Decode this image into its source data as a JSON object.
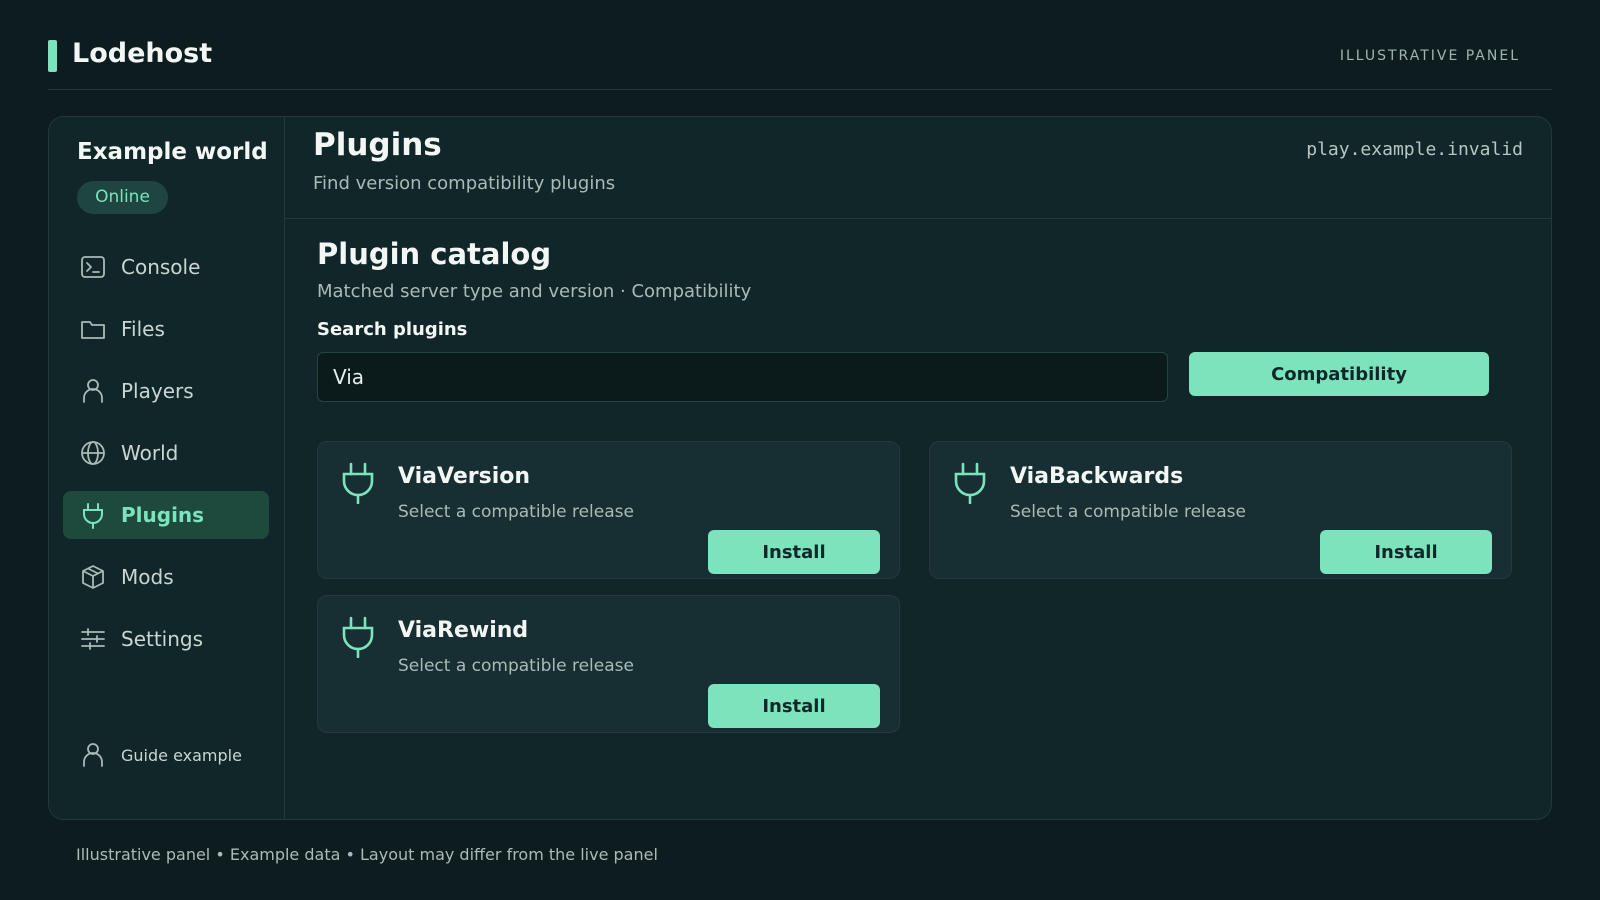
{
  "app": {
    "brand": "Lodehost",
    "top_label": "ILLUSTRATIVE PANEL",
    "accent_color": "#7ce3bd"
  },
  "sidebar": {
    "world_name": "Example world",
    "status": "Online",
    "items": [
      {
        "label": "Console",
        "icon": "terminal-icon",
        "active": false
      },
      {
        "label": "Files",
        "icon": "folder-icon",
        "active": false
      },
      {
        "label": "Players",
        "icon": "user-icon",
        "active": false
      },
      {
        "label": "World",
        "icon": "globe-icon",
        "active": false
      },
      {
        "label": "Plugins",
        "icon": "plug-icon",
        "active": true
      },
      {
        "label": "Mods",
        "icon": "package-icon",
        "active": false
      },
      {
        "label": "Settings",
        "icon": "sliders-icon",
        "active": false
      }
    ],
    "guide_label": "Guide example"
  },
  "header": {
    "title": "Plugins",
    "subtitle": "Find version compatibility plugins",
    "host": "play.example.invalid"
  },
  "catalog": {
    "title": "Plugin catalog",
    "subtitle": "Matched server type and version · Compatibility",
    "search_label": "Search plugins",
    "search_value": "Via",
    "filter_button": "Compatibility",
    "plugins": [
      {
        "name": "ViaVersion",
        "description": "Select a compatible release",
        "action": "Install"
      },
      {
        "name": "ViaBackwards",
        "description": "Select a compatible release",
        "action": "Install"
      },
      {
        "name": "ViaRewind",
        "description": "Select a compatible release",
        "action": "Install"
      }
    ]
  },
  "footer": {
    "note": "Illustrative panel • Example data • Layout may differ from the live panel"
  }
}
